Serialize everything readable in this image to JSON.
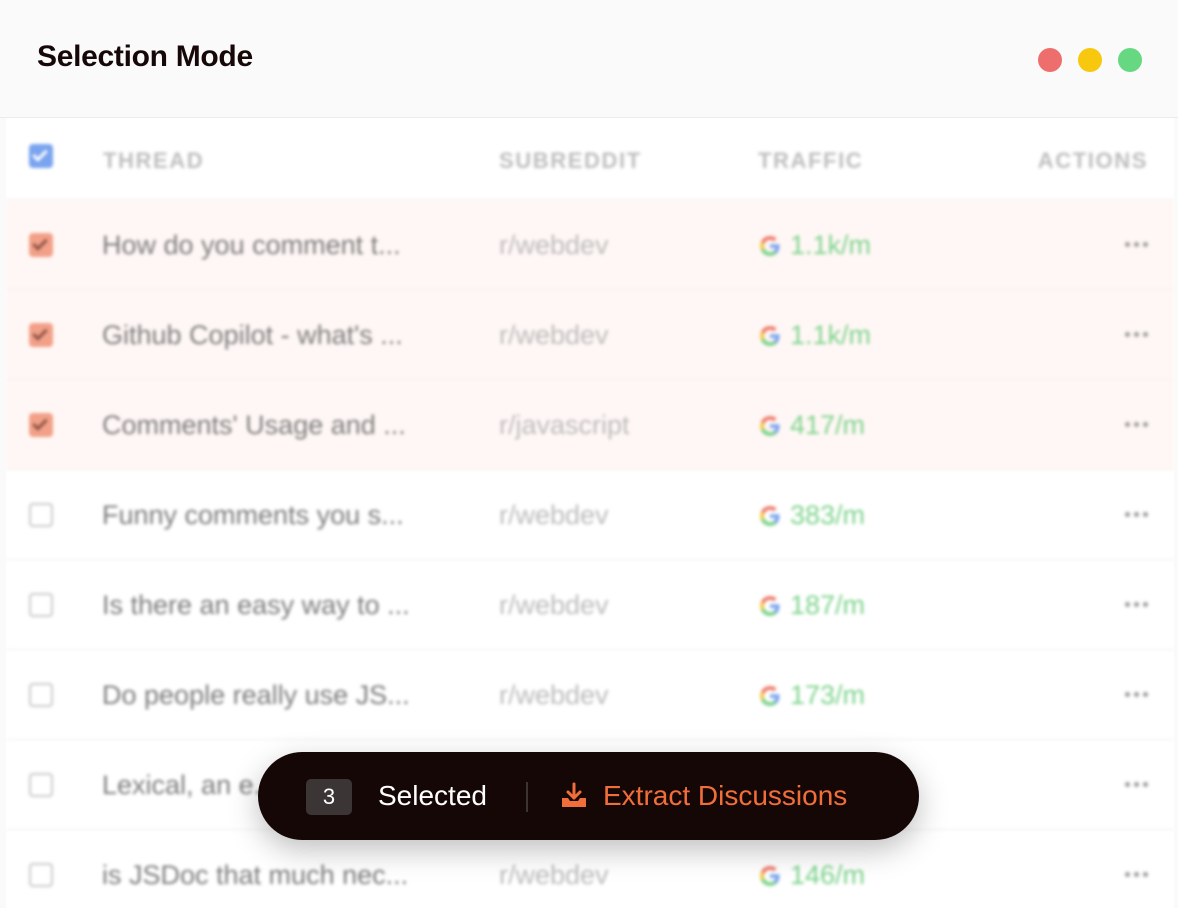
{
  "window": {
    "title": "Selection Mode",
    "controls": [
      "close",
      "minimize",
      "maximize"
    ]
  },
  "table": {
    "columns": {
      "thread": "THREAD",
      "subreddit": "SUBREDDIT",
      "traffic": "TRAFFIC",
      "actions": "ACTIONS"
    },
    "rows": [
      {
        "selected": true,
        "thread": "How do you comment t...",
        "subreddit": "r/webdev",
        "traffic": "1.1k/m"
      },
      {
        "selected": true,
        "thread": "Github Copilot - what's ...",
        "subreddit": "r/webdev",
        "traffic": "1.1k/m"
      },
      {
        "selected": true,
        "thread": "Comments' Usage and ...",
        "subreddit": "r/javascript",
        "traffic": "417/m"
      },
      {
        "selected": false,
        "thread": "Funny comments you s...",
        "subreddit": "r/webdev",
        "traffic": "383/m"
      },
      {
        "selected": false,
        "thread": "Is there an easy way to ...",
        "subreddit": "r/webdev",
        "traffic": "187/m"
      },
      {
        "selected": false,
        "thread": "Do people really use JS...",
        "subreddit": "r/webdev",
        "traffic": "173/m"
      },
      {
        "selected": false,
        "thread": "Lexical, an e...",
        "subreddit": "",
        "traffic": ""
      },
      {
        "selected": false,
        "thread": "is JSDoc that much nec...",
        "subreddit": "r/webdev",
        "traffic": "146/m"
      }
    ]
  },
  "selection_bar": {
    "count": "3",
    "label": "Selected",
    "action_label": "Extract Discussions"
  },
  "icons": {
    "traffic_source": "google-icon",
    "row_actions": "more-horizontal-icon",
    "extract": "download-tray-icon"
  },
  "colors": {
    "accent": "#f06e3a",
    "traffic": "#7ed38c",
    "header_checkbox": "#7aa4ef",
    "selected_checkbox": "#f2a088",
    "bar_background": "#160707"
  }
}
